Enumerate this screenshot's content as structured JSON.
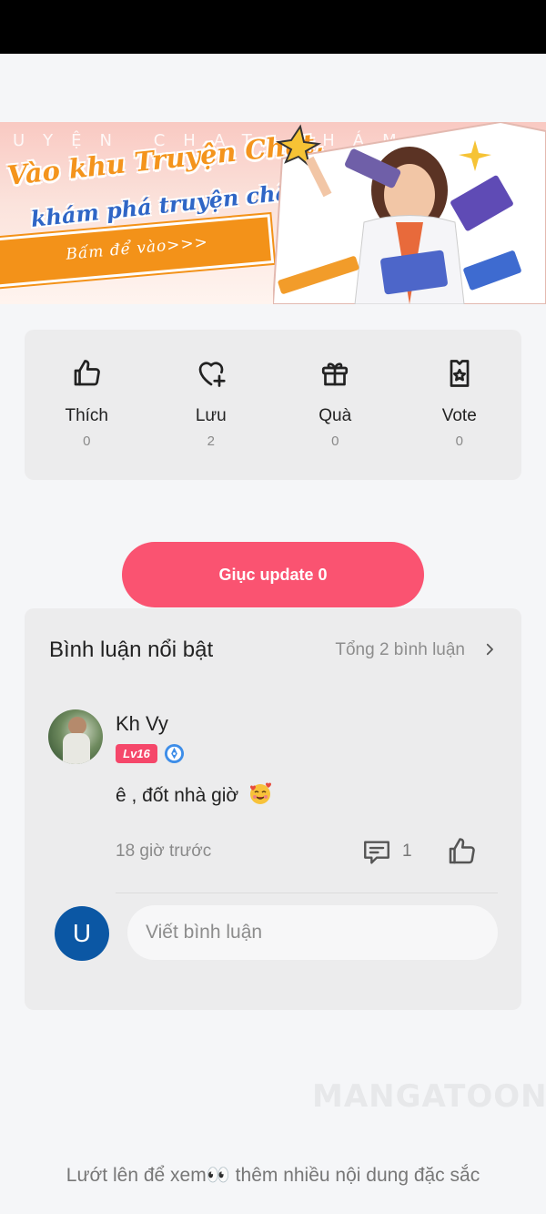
{
  "banner": {
    "bg_text": "UYỆN CHAT   KHÁM PHÁ",
    "title_line1": "Vào khu Truyện Chat,",
    "title_line2": "khám phá truyện chất",
    "cta": "Bấm để vào>>>"
  },
  "actions": [
    {
      "icon": "thumbs-up-icon",
      "label": "Thích",
      "count": "0"
    },
    {
      "icon": "heart-plus-icon",
      "label": "Lưu",
      "count": "2"
    },
    {
      "icon": "gift-icon",
      "label": "Quà",
      "count": "0"
    },
    {
      "icon": "vote-badge-icon",
      "label": "Vote",
      "count": "0"
    }
  ],
  "update_button": "Giục update 0",
  "comments": {
    "title": "Bình luận nổi bật",
    "total": "Tổng 2 bình luận",
    "items": [
      {
        "username": "Kh Vy",
        "level": "Lv16",
        "text": "ê , đốt nhà giờ",
        "emoji": "smiling-face-with-hearts",
        "time": "18 giờ trước",
        "reply_count": "1"
      }
    ],
    "my_avatar_initial": "U",
    "input_placeholder": "Viết bình luận"
  },
  "watermark": "MANGATOON",
  "footer": "Lướt lên để xem👀 thêm nhiều nội dung đặc sắc",
  "colors": {
    "accent": "#fa5371",
    "badge": "#f5476a",
    "user_avatar": "#0b57a4",
    "banner_orange": "#f39219",
    "banner_blue": "#2f66c6"
  }
}
